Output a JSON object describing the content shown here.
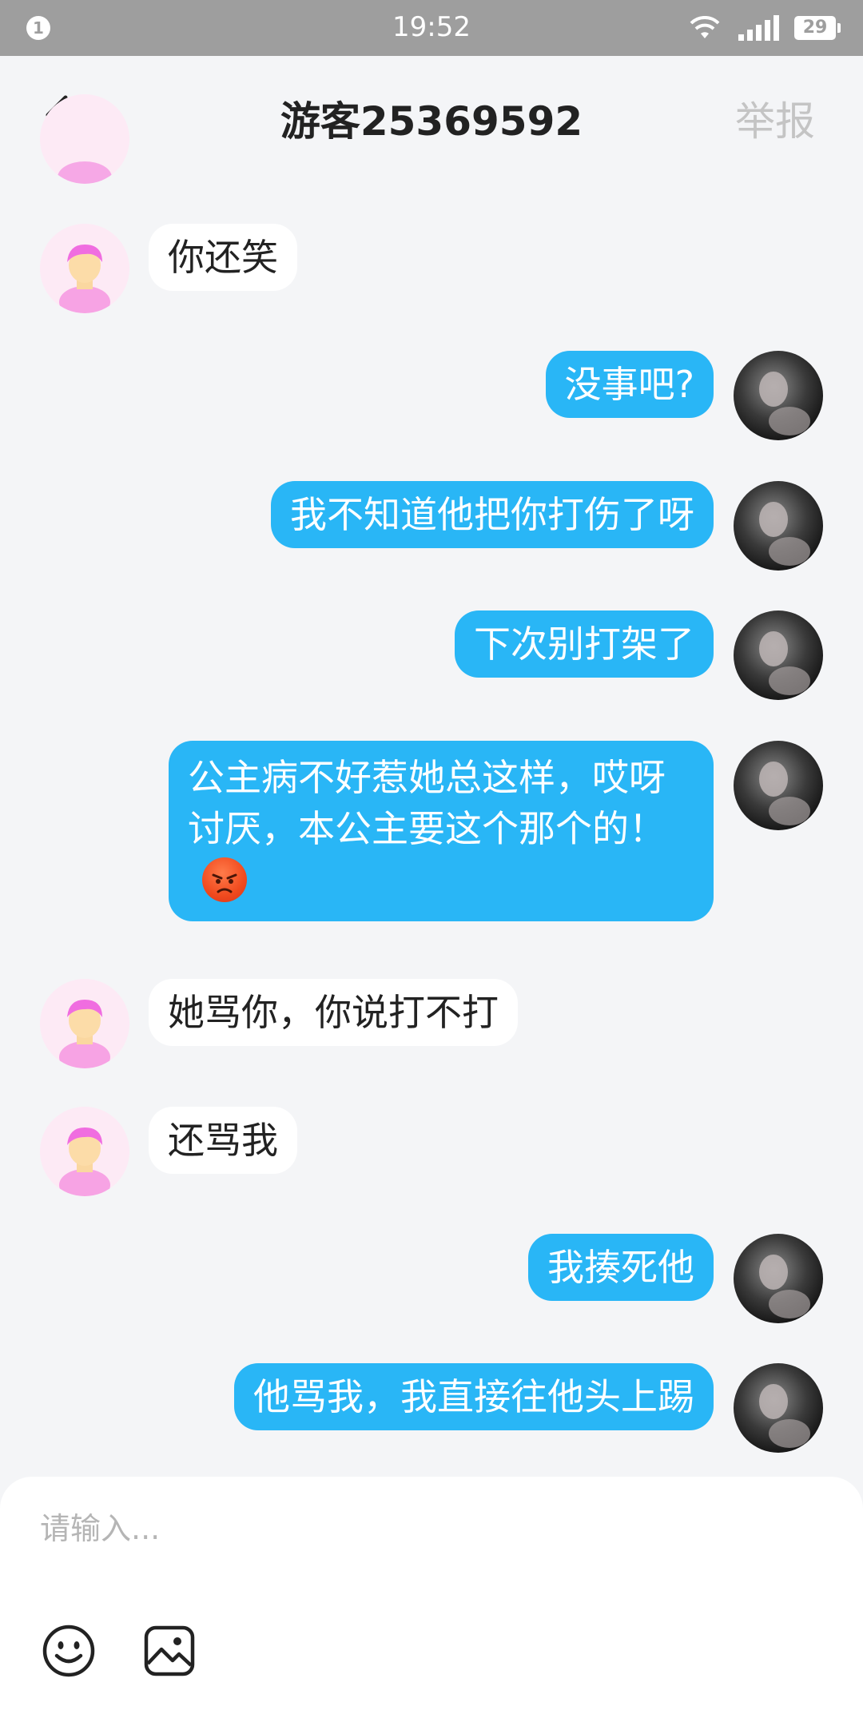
{
  "status_bar": {
    "notification_count": "1",
    "time": "19:52",
    "battery": "29"
  },
  "header": {
    "title": "游客25369592",
    "report_label": "举报"
  },
  "messages": [
    {
      "sender": "other",
      "text": "你还笑"
    },
    {
      "sender": "self",
      "text": "没事吧?"
    },
    {
      "sender": "self",
      "text": "我不知道他把你打伤了呀"
    },
    {
      "sender": "self",
      "text": "下次别打架了"
    },
    {
      "sender": "self",
      "text": "公主病不好惹她总这样，哎呀讨厌，本公主要这个那个的！",
      "emoji": "angry-face-emoji"
    },
    {
      "sender": "other",
      "text": "她骂你，你说打不打"
    },
    {
      "sender": "other",
      "text": "还骂我"
    },
    {
      "sender": "self",
      "text": "我揍死他"
    },
    {
      "sender": "self",
      "text": "他骂我，我直接往他头上踢"
    }
  ],
  "input": {
    "placeholder": "请输入..."
  },
  "toolbar_icons": [
    "emoji-icon",
    "image-icon"
  ],
  "colors": {
    "self_bubble": "#29b6f6",
    "other_bubble": "#ffffff",
    "background": "#f4f5f7",
    "status_bar": "#9e9e9e"
  }
}
